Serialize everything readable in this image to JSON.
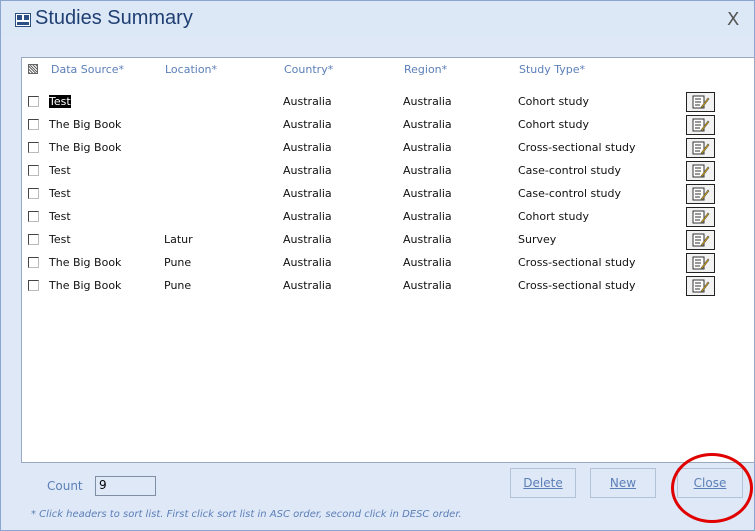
{
  "window": {
    "title": "Studies Summary",
    "close_glyph": "X",
    "app_icon": "database-app-icon"
  },
  "table": {
    "headers": [
      "Data Source*",
      "Location*",
      "Country*",
      "Region*",
      "Study Type*"
    ],
    "rows": [
      {
        "data_source": "Test",
        "location": "",
        "country": "Australia",
        "region": "Australia",
        "study_type": "Cohort study",
        "selected": true
      },
      {
        "data_source": "The Big Book",
        "location": "",
        "country": "Australia",
        "region": "Australia",
        "study_type": "Cohort study"
      },
      {
        "data_source": "The Big Book",
        "location": "",
        "country": "Australia",
        "region": "Australia",
        "study_type": "Cross-sectional study"
      },
      {
        "data_source": "Test",
        "location": "",
        "country": "Australia",
        "region": "Australia",
        "study_type": "Case-control study"
      },
      {
        "data_source": "Test",
        "location": "",
        "country": "Australia",
        "region": "Australia",
        "study_type": "Case-control study"
      },
      {
        "data_source": "Test",
        "location": "",
        "country": "Australia",
        "region": "Australia",
        "study_type": "Cohort study"
      },
      {
        "data_source": "Test",
        "location": "Latur",
        "country": "Australia",
        "region": "Australia",
        "study_type": "Survey"
      },
      {
        "data_source": "The Big Book",
        "location": "Pune",
        "country": "Australia",
        "region": "Australia",
        "study_type": "Cross-sectional study"
      },
      {
        "data_source": "The Big Book",
        "location": "Pune",
        "country": "Australia",
        "region": "Australia",
        "study_type": "Cross-sectional study"
      }
    ],
    "edit_icon": "edit-record-icon"
  },
  "footer": {
    "count_label": "Count",
    "count_value": "9",
    "delete_label": "Delete",
    "new_label": "New",
    "close_label": "Close",
    "note": "* Click headers to sort list. First click sort list in ASC order, second click in DESC order."
  },
  "colors": {
    "accent_text": "#5b7fb8",
    "window_bg": "#dfe8f6",
    "highlight_circle": "#e00000"
  }
}
